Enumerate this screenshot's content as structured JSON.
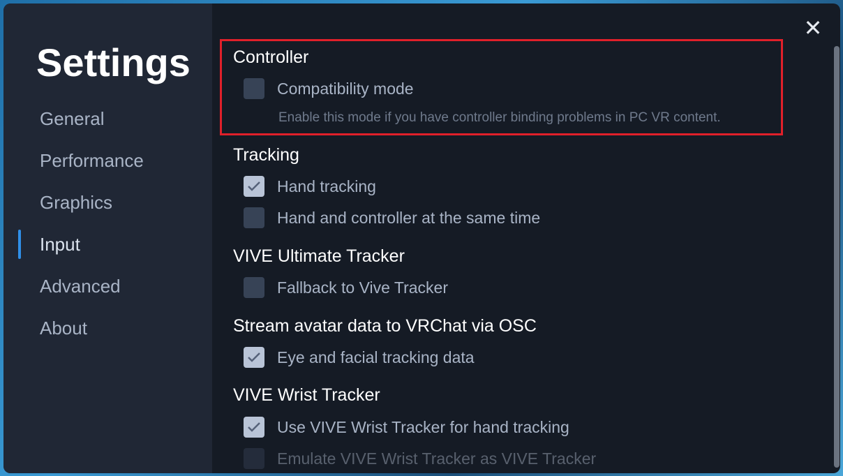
{
  "sidebar": {
    "title": "Settings",
    "items": [
      {
        "label": "General"
      },
      {
        "label": "Performance"
      },
      {
        "label": "Graphics"
      },
      {
        "label": "Input",
        "active": true
      },
      {
        "label": "Advanced"
      },
      {
        "label": "About"
      }
    ]
  },
  "main": {
    "controller": {
      "heading": "Controller",
      "compat": {
        "label": "Compatibility mode",
        "checked": false
      },
      "description": "Enable this mode if you have controller binding problems in PC VR content."
    },
    "tracking": {
      "heading": "Tracking",
      "hand": {
        "label": "Hand tracking",
        "checked": true
      },
      "both": {
        "label": "Hand and controller at the same time",
        "checked": false
      }
    },
    "ultimate": {
      "heading": "VIVE Ultimate Tracker",
      "fallback": {
        "label": "Fallback to Vive Tracker",
        "checked": false
      }
    },
    "osc": {
      "heading": "Stream avatar data to VRChat via OSC",
      "eye": {
        "label": "Eye and facial tracking data",
        "checked": true
      }
    },
    "wrist": {
      "heading": "VIVE Wrist Tracker",
      "use": {
        "label": "Use VIVE Wrist Tracker for hand tracking",
        "checked": true
      },
      "emulate": {
        "label": "Emulate VIVE Wrist Tracker as VIVE Tracker",
        "checked": false,
        "disabled": true
      }
    }
  },
  "colors": {
    "highlight": "#e0202a",
    "accent": "#2f8fe8"
  }
}
